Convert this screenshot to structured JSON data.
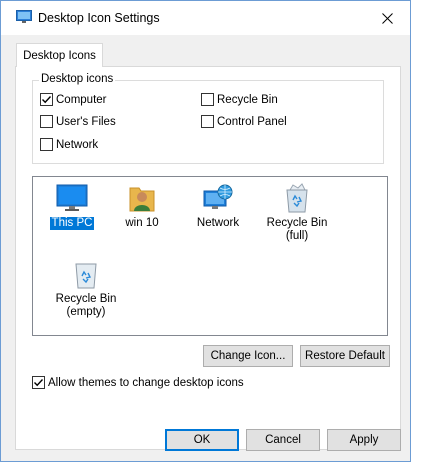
{
  "window": {
    "title": "Desktop Icon Settings"
  },
  "tabs": [
    {
      "label": "Desktop Icons"
    }
  ],
  "group": {
    "legend": "Desktop icons",
    "checkboxes": [
      {
        "label": "Computer",
        "checked": true
      },
      {
        "label": "Recycle Bin",
        "checked": false
      },
      {
        "label": "User's Files",
        "checked": false
      },
      {
        "label": "Control Panel",
        "checked": false
      },
      {
        "label": "Network",
        "checked": false
      }
    ]
  },
  "icons": [
    {
      "label": "This PC",
      "icon": "monitor-icon",
      "selected": true
    },
    {
      "label": "win 10",
      "icon": "user-folder-icon",
      "selected": false
    },
    {
      "label": "Network",
      "icon": "network-icon",
      "selected": false
    },
    {
      "label": "Recycle Bin\n(full)",
      "icon": "recycle-bin-full-icon",
      "selected": false
    },
    {
      "label": "Recycle Bin\n(empty)",
      "icon": "recycle-bin-empty-icon",
      "selected": false
    }
  ],
  "buttons": {
    "change_icon": "Change Icon...",
    "restore_default": "Restore Default",
    "ok": "OK",
    "cancel": "Cancel",
    "apply": "Apply"
  },
  "allow_themes": {
    "label": "Allow themes to change desktop icons",
    "checked": true
  },
  "colors": {
    "selection": "#0078d7",
    "dialog_bg": "#f0f0f0",
    "window_border": "#6c9cd4"
  }
}
